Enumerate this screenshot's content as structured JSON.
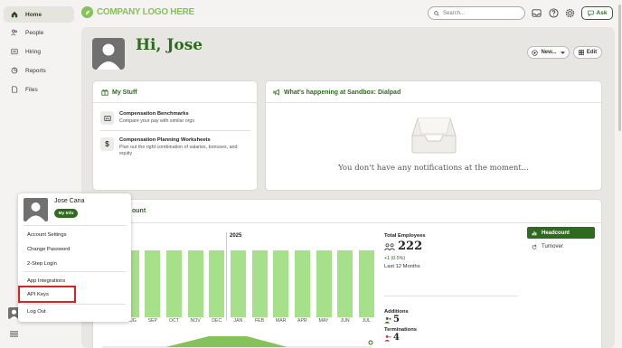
{
  "sidebar": {
    "items": [
      {
        "label": "Home",
        "icon": "home-icon"
      },
      {
        "label": "People",
        "icon": "people-icon"
      },
      {
        "label": "Hiring",
        "icon": "hiring-icon"
      },
      {
        "label": "Reports",
        "icon": "reports-icon"
      },
      {
        "label": "Files",
        "icon": "files-icon"
      }
    ]
  },
  "header": {
    "logo_text": "COMPANY LOGO HERE",
    "search_placeholder": "Search...",
    "ask_label": "Ask"
  },
  "welcome": {
    "greeting": "Hi, Jose",
    "new_label": "New...",
    "edit_label": "Edit"
  },
  "my_stuff": {
    "title": "My Stuff",
    "items": [
      {
        "title": "Compensation Benchmarks",
        "desc": "Compare your pay with similar orgs"
      },
      {
        "title": "Compensation Planning Worksheets",
        "desc": "Plan out the right combination of salaries, bonuses, and equity"
      }
    ]
  },
  "happening": {
    "title": "What's happening at Sandbox: Dialpad",
    "empty": "You don't have any notifications at the moment..."
  },
  "headcount_card": {
    "title_fragment": "ount",
    "year": "2025",
    "months": [
      "JUL",
      "AUG",
      "SEP",
      "OCT",
      "NOV",
      "DEC",
      "JAN",
      "FEB",
      "MAR",
      "APR",
      "MAY",
      "JUN",
      "JUL"
    ],
    "total_label": "Total Employees",
    "total_value": "222",
    "change": "+1 (0.5%)",
    "period": "Last 12 Months",
    "additions_label": "Additions",
    "additions_value": "5",
    "terminations_label": "Terminations",
    "terminations_value": "4",
    "tabs": [
      "Headcount",
      "Turnover"
    ]
  },
  "user_menu": {
    "name": "Jose Cana",
    "my_info": "My Info",
    "items": [
      "Account Settings",
      "Change Password",
      "2-Step Login",
      "App Integrations",
      "API Keys",
      "Log Out"
    ]
  },
  "colors": {
    "accent": "#2e6b1f",
    "bar": "#a7e08a",
    "highlight_box": "#e02020"
  }
}
